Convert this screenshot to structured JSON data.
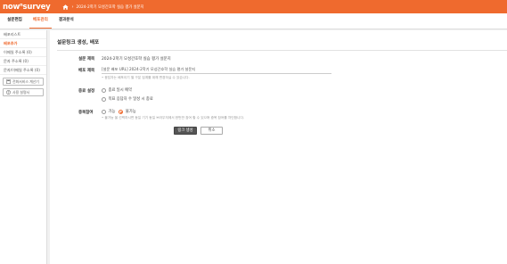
{
  "header": {
    "logo": "nowsurvey",
    "logo_sup": "n",
    "breadcrumb_separator": "›",
    "breadcrumb_title": "2024-2학기 모성간호학 실습 평가 설문지"
  },
  "tabs": [
    {
      "label": "설문편집"
    },
    {
      "label": "배포관리"
    },
    {
      "label": "결과분석"
    }
  ],
  "sidebar": {
    "items": [
      {
        "label": "배포리스트"
      },
      {
        "label": "배포추가"
      },
      {
        "label": "이메일 주소록 (0)"
      },
      {
        "label": "문자 주소록 (0)"
      },
      {
        "label": "문자/이메일 주소록 (0)"
      }
    ],
    "buttons": [
      {
        "label": "전화서비스 계산기"
      },
      {
        "label": "사용 설명서"
      }
    ]
  },
  "main": {
    "title": "설문링크 생성, 배포",
    "survey_title_label": "설문 제목",
    "survey_title_value": "2024-2학기 모성간호학 실습 평가 설문지",
    "deploy_name_label": "배포 제목",
    "deploy_name_value": "[설문 배포 URL] 2024-2학기 모성간호학 실습 평가 설문지",
    "deploy_name_help": "• 응답자는 배포이기 별 구분 집계를 위해 변경하실 수 있습니다.",
    "end_label": "종료 설정",
    "end_options": [
      {
        "label": "종료 일시 예약"
      },
      {
        "label": "목표 응답자 수 달성 시 종료"
      }
    ],
    "dup_label": "중복참여",
    "dup_options": [
      {
        "label": "가능"
      },
      {
        "label": "불가능"
      }
    ],
    "dup_help": "• 불가능 을 선택하시면 동일 기기 동일 브라우저에서 한번만 참여 할 수 있으며 중복 참여를 차단합니다.",
    "create_button": "링크 생성",
    "cancel_button": "취소"
  },
  "colors": {
    "accent": "#ef6a2e",
    "primary_button": "#555555"
  }
}
